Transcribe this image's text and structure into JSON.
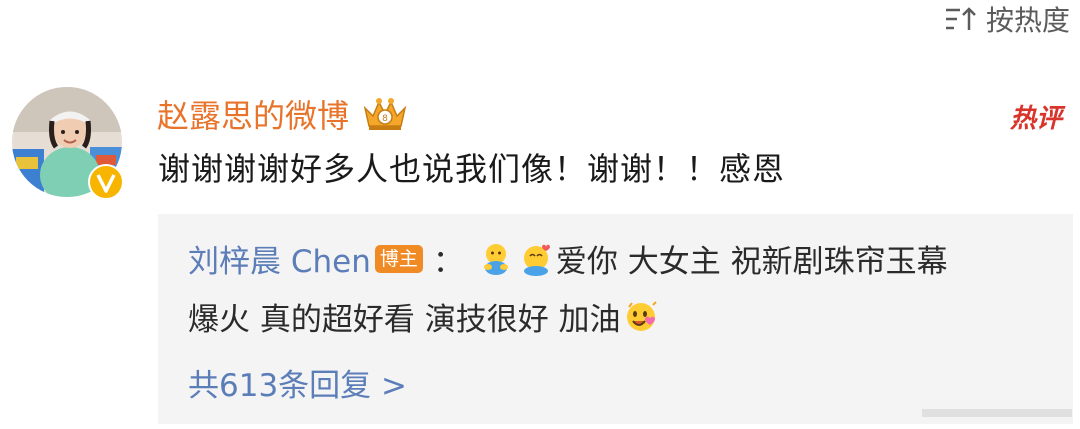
{
  "sort": {
    "label": "按热度",
    "icon": "sort-icon"
  },
  "comment": {
    "author": "赵露思的微博",
    "author_color": "#e8742c",
    "avatar_icon": "avatar",
    "verified_icon": "verified-badge-icon",
    "crown_icon": "crown-badge-icon",
    "hot_badge": {
      "label": "热评",
      "color": "#d9342b"
    },
    "text": "谢谢谢谢好多人也说我们像！谢谢！！感恩"
  },
  "reply": {
    "author": "刘梓晨 Chen",
    "author_tag": "博主",
    "tag_color": "#f08a24",
    "separator": "：",
    "line1": "爱你 大女主 祝新剧珠帘玉幕",
    "line2": "爆火 真的超好看 演技很好 加油",
    "emoji_icons": [
      "hug-emoji-icon",
      "hug-heart-emoji-icon",
      "love-emoji-icon"
    ],
    "reply_count_label": "共613条回复 >",
    "link_color": "#5b7db8"
  }
}
